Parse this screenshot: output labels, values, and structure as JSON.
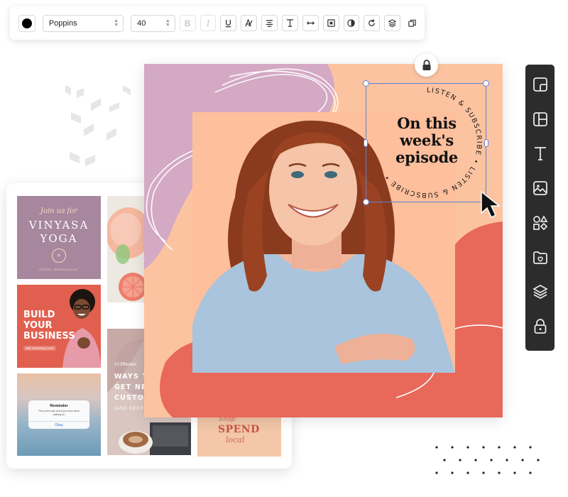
{
  "toolbar": {
    "text_color": "#000000",
    "font_family": "Poppins",
    "font_size": "40",
    "bold_label": "B",
    "italic_label": "I",
    "icons": [
      "color-swatch-icon",
      "bold-icon",
      "italic-icon",
      "underline-icon",
      "text-style-icon",
      "align-center-icon",
      "vertical-align-icon",
      "letter-spacing-icon",
      "frame-icon",
      "transparency-icon",
      "redo-icon",
      "layers-icon",
      "duplicate-icon"
    ]
  },
  "canvas": {
    "background": "#fcc3a0",
    "accent_colors": [
      "#e8685a",
      "#d3a9c4",
      "#ffffff"
    ],
    "headline": "On this\nweek's\nepisode",
    "circular_text": "LISTEN & SUBSCRIBE • LISTEN & SUBSCRIBE •",
    "locked": true
  },
  "templates": {
    "yoga": {
      "script": "Join us for",
      "line1": "VINYASA",
      "line2": "YOGA",
      "seal": "✿",
      "footer": "EVERY WEDNESDAY"
    },
    "business": {
      "line1": "BUILD",
      "line2": "YOUR",
      "line3": "BUSINESS",
      "sub": "with Marketing tools"
    },
    "ways": {
      "tag": "10 Effective",
      "line1": "WAYS T",
      "line2": "GET NE",
      "line3": "CUSTOM",
      "line4": "(AND KEEP"
    },
    "reminder": {
      "title": "Reminder",
      "message": "This is the sale event you have been waiting for",
      "action": "Okay"
    },
    "spend": {
      "line1": "Shop",
      "line2": "SPEND",
      "line3": "local"
    }
  },
  "sidebar": {
    "items": [
      {
        "name": "sidebar-templates",
        "icon": "template-icon"
      },
      {
        "name": "sidebar-layouts",
        "icon": "layout-icon"
      },
      {
        "name": "sidebar-text",
        "icon": "text-icon"
      },
      {
        "name": "sidebar-images",
        "icon": "image-icon"
      },
      {
        "name": "sidebar-elements",
        "icon": "shapes-icon"
      },
      {
        "name": "sidebar-uploads",
        "icon": "folder-icon"
      },
      {
        "name": "sidebar-layers",
        "icon": "layers-icon"
      },
      {
        "name": "sidebar-lock",
        "icon": "lock-icon"
      }
    ]
  }
}
